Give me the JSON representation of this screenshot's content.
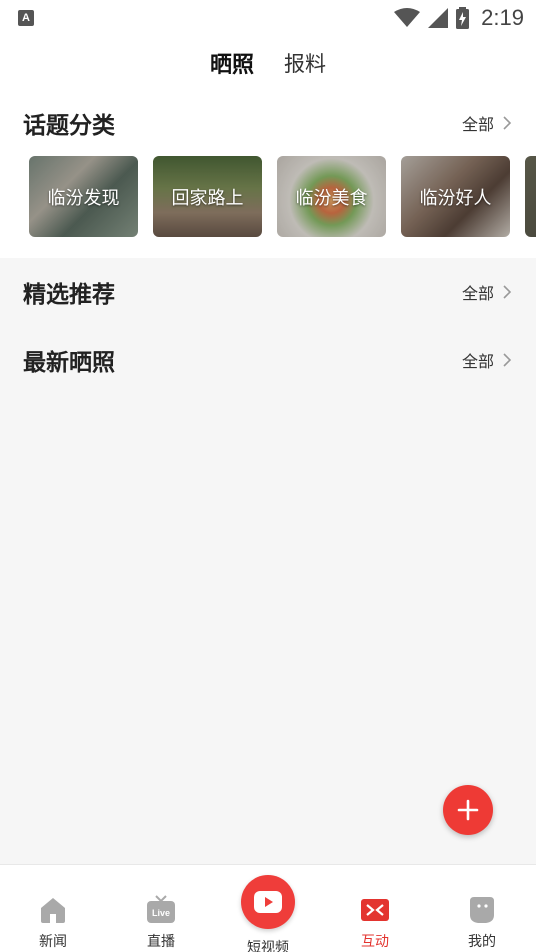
{
  "status": {
    "time": "2:19",
    "notification_letter": "A"
  },
  "top_tabs": [
    {
      "label": "晒照",
      "active": true
    },
    {
      "label": "报料",
      "active": false
    }
  ],
  "topic_section": {
    "title": "话题分类",
    "more_label": "全部",
    "topics": [
      {
        "label": "临汾发现"
      },
      {
        "label": "回家路上"
      },
      {
        "label": "临汾美食"
      },
      {
        "label": "临汾好人"
      }
    ]
  },
  "featured_section": {
    "title": "精选推荐",
    "more_label": "全部"
  },
  "latest_section": {
    "title": "最新晒照",
    "more_label": "全部"
  },
  "bottom_nav": [
    {
      "label": "新闻",
      "icon": "home-icon"
    },
    {
      "label": "直播",
      "icon": "live-tv-icon"
    },
    {
      "label": "短视频",
      "icon": "play-video-icon"
    },
    {
      "label": "互动",
      "icon": "interact-icon",
      "active": true
    },
    {
      "label": "我的",
      "icon": "profile-icon"
    }
  ],
  "colors": {
    "accent": "#e3342f",
    "fab": "#ee3a35"
  }
}
